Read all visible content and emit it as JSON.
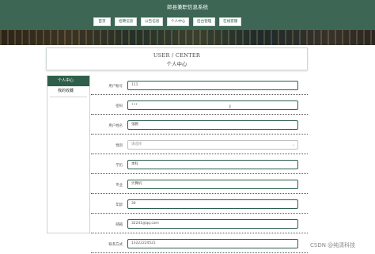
{
  "header": {
    "site_title": "郎县兼职信息系统"
  },
  "nav": {
    "items": [
      {
        "label": "首页"
      },
      {
        "label": "招聘信息"
      },
      {
        "label": "公告信息"
      },
      {
        "label": "个人中心"
      },
      {
        "label": "后台管理"
      },
      {
        "label": "在线客服"
      }
    ]
  },
  "center": {
    "title_en": "USER / CENTER",
    "title_cn": "个人中心"
  },
  "sidebar": {
    "items": [
      {
        "label": "个人中心",
        "active": true
      },
      {
        "label": "我的收藏",
        "active": false
      }
    ]
  },
  "form": {
    "fields": [
      {
        "label": "用户账号",
        "value": "111"
      },
      {
        "label": "密码",
        "value": "•••"
      },
      {
        "label": "用户姓名",
        "value": "张鹏"
      },
      {
        "label": "性别",
        "value": "请选择"
      },
      {
        "label": "学历",
        "value": "本科"
      },
      {
        "label": "专业",
        "value": "计算机"
      },
      {
        "label": "年龄",
        "value": "30"
      },
      {
        "label": "邮箱",
        "value": "32241@qq.com"
      },
      {
        "label": "联系方式",
        "value": "13222224521"
      }
    ]
  },
  "colors": {
    "accent": "#3d6654",
    "sidebar_active": "#2f5e4a"
  },
  "watermark": "CSDN @纯清科技"
}
